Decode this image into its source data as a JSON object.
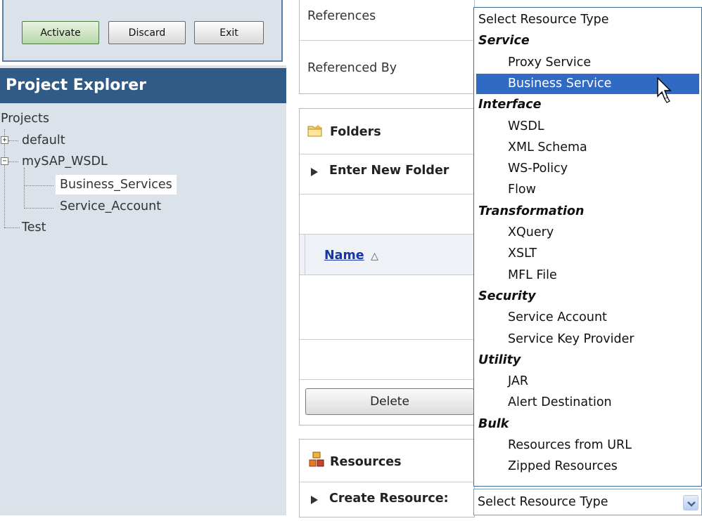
{
  "change_center": {
    "activate_label": "Activate",
    "discard_label": "Discard",
    "exit_label": "Exit"
  },
  "project_explorer": {
    "title": "Project Explorer",
    "root_label": "Projects",
    "items": [
      {
        "label": "default"
      },
      {
        "label": "mySAP_WSDL"
      },
      {
        "label": "Business_Services"
      },
      {
        "label": "Service_Account"
      },
      {
        "label": "Test"
      }
    ]
  },
  "detail": {
    "references_label": "References",
    "referenced_by_label": "Referenced By",
    "folders_title": "Folders",
    "enter_new_folder_label": "Enter New Folder",
    "name_column": "Name",
    "delete_label": "Delete",
    "resources_title": "Resources",
    "create_resource_label": "Create Resource:"
  },
  "resource_dropdown": {
    "selected_value": "Select Resource Type",
    "highlighted": "Business Service",
    "items": [
      {
        "text": "Select Resource Type",
        "kind": "header-plain"
      },
      {
        "text": "Service",
        "kind": "group"
      },
      {
        "text": "Proxy Service",
        "kind": "option"
      },
      {
        "text": "Business Service",
        "kind": "option"
      },
      {
        "text": "Interface",
        "kind": "group"
      },
      {
        "text": "WSDL",
        "kind": "option"
      },
      {
        "text": "XML Schema",
        "kind": "option"
      },
      {
        "text": "WS-Policy",
        "kind": "option"
      },
      {
        "text": "Flow",
        "kind": "option"
      },
      {
        "text": "Transformation",
        "kind": "group"
      },
      {
        "text": "XQuery",
        "kind": "option"
      },
      {
        "text": "XSLT",
        "kind": "option"
      },
      {
        "text": "MFL File",
        "kind": "option"
      },
      {
        "text": "Security",
        "kind": "group"
      },
      {
        "text": "Service Account",
        "kind": "option"
      },
      {
        "text": "Service Key Provider",
        "kind": "option"
      },
      {
        "text": "Utility",
        "kind": "group"
      },
      {
        "text": "JAR",
        "kind": "option"
      },
      {
        "text": "Alert Destination",
        "kind": "option"
      },
      {
        "text": "Bulk",
        "kind": "group"
      },
      {
        "text": "Resources from URL",
        "kind": "option"
      },
      {
        "text": "Zipped Resources",
        "kind": "option"
      }
    ]
  },
  "colors": {
    "header_bg": "#2f5b86",
    "panel_bg": "#dbe2ea",
    "selection": "#316ac5",
    "link": "#1536a8"
  },
  "icons": [
    "folder-icon",
    "resources-icon",
    "expand-icon",
    "collapse-icon",
    "dropdown-arrow-icon",
    "mouse-cursor-icon"
  ]
}
